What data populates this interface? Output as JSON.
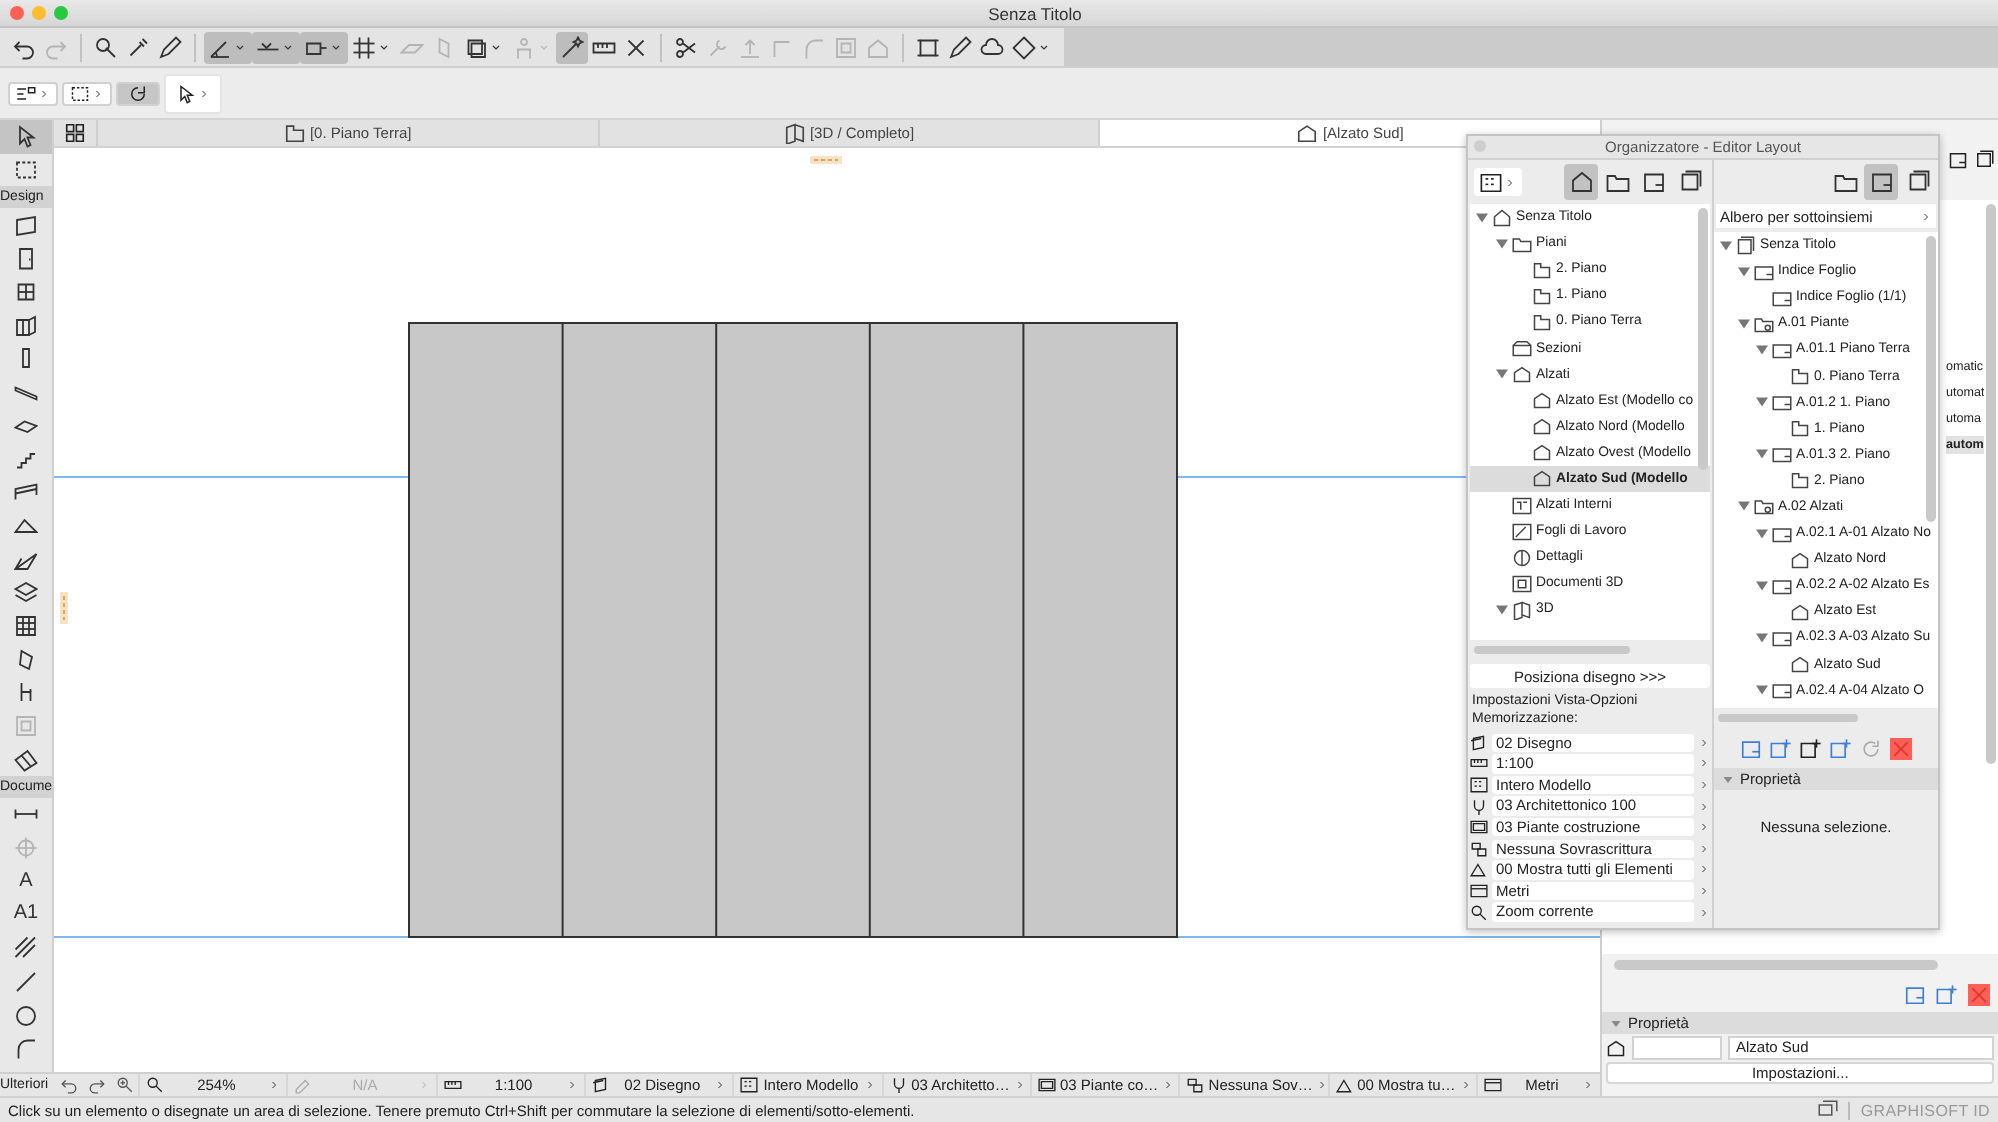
{
  "window": {
    "title": "Senza Titolo"
  },
  "toolbar_groups": [
    {
      "items": [
        {
          "kind": "undo",
          "on": false,
          "disabled": false,
          "menu": false
        },
        {
          "kind": "redo",
          "on": false,
          "disabled": true,
          "menu": false
        }
      ]
    },
    {
      "items": [
        {
          "kind": "pick",
          "on": false,
          "disabled": false,
          "menu": false
        },
        {
          "kind": "eyedropper",
          "on": false,
          "disabled": false,
          "menu": false
        },
        {
          "kind": "pen",
          "on": false,
          "disabled": false,
          "menu": false
        }
      ]
    },
    {
      "items": [
        {
          "kind": "angle",
          "on": true,
          "disabled": false,
          "menu": true
        },
        {
          "kind": "guide",
          "on": true,
          "disabled": false,
          "menu": true
        },
        {
          "kind": "gravity",
          "on": true,
          "disabled": false,
          "menu": true
        },
        {
          "kind": "grid",
          "on": false,
          "disabled": false,
          "menu": true
        },
        {
          "kind": "plane",
          "on": false,
          "disabled": true,
          "menu": false
        },
        {
          "kind": "wallplane",
          "on": false,
          "disabled": true,
          "menu": false
        },
        {
          "kind": "layers",
          "on": false,
          "disabled": false,
          "menu": true
        },
        {
          "kind": "person",
          "on": false,
          "disabled": true,
          "menu": true
        },
        {
          "kind": "wand",
          "on": true,
          "disabled": false,
          "menu": false
        },
        {
          "kind": "ruler",
          "on": false,
          "disabled": false,
          "menu": false
        },
        {
          "kind": "cross",
          "on": false,
          "disabled": false,
          "menu": false
        }
      ]
    },
    {
      "items": [
        {
          "kind": "scissors",
          "on": false,
          "disabled": false,
          "menu": false
        },
        {
          "kind": "wrench",
          "on": false,
          "disabled": true,
          "menu": false
        },
        {
          "kind": "elevate",
          "on": false,
          "disabled": true,
          "menu": false
        },
        {
          "kind": "corner",
          "on": false,
          "disabled": true,
          "menu": false
        },
        {
          "kind": "arc",
          "on": false,
          "disabled": true,
          "menu": false
        },
        {
          "kind": "zone",
          "on": false,
          "disabled": true,
          "menu": false
        },
        {
          "kind": "house",
          "on": false,
          "disabled": true,
          "menu": false
        }
      ]
    },
    {
      "items": [
        {
          "kind": "frame",
          "on": false,
          "disabled": false,
          "menu": false
        },
        {
          "kind": "pen",
          "on": false,
          "disabled": false,
          "menu": false
        },
        {
          "kind": "cloud",
          "on": false,
          "disabled": false,
          "menu": false
        },
        {
          "kind": "diamond",
          "on": false,
          "disabled": false,
          "menu": true
        }
      ]
    }
  ],
  "tool_options": [
    {
      "kind": "filter",
      "on": false,
      "menu": true
    },
    {
      "kind": "marquee",
      "on": false,
      "menu": true
    },
    {
      "kind": "rotate",
      "on": true,
      "menu": false
    },
    {
      "kind": "arrow",
      "on": false,
      "menu": true
    }
  ],
  "view_tabs": [
    {
      "kind": "story",
      "label": "[0. Piano Terra]",
      "selected": false
    },
    {
      "kind": "threed",
      "label": "[3D / Completo]",
      "selected": false
    },
    {
      "kind": "elevation",
      "label": "[Alzato Sud]",
      "selected": true
    }
  ],
  "toolbox": {
    "top_tools": [
      {
        "kind": "arrow",
        "selected": true,
        "disabled": false
      },
      {
        "kind": "marquee",
        "selected": false,
        "disabled": false
      }
    ],
    "sections": [
      {
        "label": "Design",
        "tools": [
          {
            "kind": "wall",
            "selected": false,
            "disabled": false
          },
          {
            "kind": "door",
            "selected": false,
            "disabled": false
          },
          {
            "kind": "window",
            "selected": false,
            "disabled": false
          },
          {
            "kind": "cornerwindow",
            "selected": false,
            "disabled": false
          },
          {
            "kind": "column",
            "selected": false,
            "disabled": false
          },
          {
            "kind": "beam",
            "selected": false,
            "disabled": false
          },
          {
            "kind": "slab",
            "selected": false,
            "disabled": false
          },
          {
            "kind": "stair",
            "selected": false,
            "disabled": false
          },
          {
            "kind": "railing",
            "selected": false,
            "disabled": false
          },
          {
            "kind": "roof",
            "selected": false,
            "disabled": false
          },
          {
            "kind": "shell",
            "selected": false,
            "disabled": false
          },
          {
            "kind": "skylight",
            "selected": false,
            "disabled": false
          },
          {
            "kind": "curtainwall",
            "selected": false,
            "disabled": false
          },
          {
            "kind": "morph",
            "selected": false,
            "disabled": false
          },
          {
            "kind": "object",
            "selected": false,
            "disabled": false
          },
          {
            "kind": "zone",
            "selected": false,
            "disabled": true
          },
          {
            "kind": "mesh",
            "selected": false,
            "disabled": false
          }
        ]
      },
      {
        "label": "Docume",
        "tools": [
          {
            "kind": "dimension",
            "selected": false,
            "disabled": false
          },
          {
            "kind": "level",
            "selected": false,
            "disabled": true
          },
          {
            "kind": "text",
            "glyph": "A",
            "selected": false,
            "disabled": false
          },
          {
            "kind": "label",
            "glyph": "A1",
            "selected": false,
            "disabled": false
          },
          {
            "kind": "fill",
            "selected": false,
            "disabled": false
          },
          {
            "kind": "line",
            "selected": false,
            "disabled": false
          },
          {
            "kind": "circle",
            "selected": false,
            "disabled": false
          },
          {
            "kind": "arc",
            "selected": false,
            "disabled": false
          }
        ]
      }
    ],
    "more_label": "Ulteriori"
  },
  "status_bar": {
    "items": [
      {
        "kind": "zoom",
        "text": "254%",
        "disabled": false
      },
      {
        "kind": "markup",
        "text": "N/A",
        "disabled": true
      },
      {
        "kind": "scale",
        "text": "1:100",
        "disabled": false
      },
      {
        "kind": "layer-combo",
        "text": "02 Disegno",
        "disabled": false
      },
      {
        "kind": "model",
        "text": "Intero Modello",
        "disabled": false
      },
      {
        "kind": "pen-set",
        "text": "03 Architetto…",
        "disabled": false
      },
      {
        "kind": "mvo",
        "text": "03 Piante co…",
        "disabled": false
      },
      {
        "kind": "override",
        "text": "Nessuna Sov…",
        "disabled": false
      },
      {
        "kind": "renovation",
        "text": "00 Mostra tu…",
        "disabled": false
      },
      {
        "kind": "units",
        "text": "Metri",
        "disabled": false
      }
    ]
  },
  "message": "Click su un elemento o disegnate un area di selezione. Tenere premuto Ctrl+Shift per commutare la selezione di elementi/sotto-elementi.",
  "brand": "GRAPHISOFT ID",
  "side_panel": {
    "cut_texts": [
      {
        "text": "omatic",
        "bold": false
      },
      {
        "text": "utomat",
        "bold": false
      },
      {
        "text": "utoma",
        "bold": false
      },
      {
        "text": "autom",
        "bold": true
      }
    ],
    "properties_title": "Proprietà",
    "name_value": "Alzato Sud",
    "settings_button": "Impostazioni..."
  },
  "organizer": {
    "title": "Organizzatore - Editor Layout",
    "left_modes": [
      {
        "kind": "project",
        "selected": true
      },
      {
        "kind": "viewmap",
        "selected": false
      },
      {
        "kind": "layout",
        "selected": false
      },
      {
        "kind": "publisher",
        "selected": false
      }
    ],
    "view_tree": [
      {
        "kind": "project",
        "label": "Senza Titolo",
        "selected": false,
        "expanded": true,
        "children": [
          {
            "kind": "folder",
            "label": "Piani",
            "selected": false,
            "expanded": true,
            "children": [
              {
                "kind": "story",
                "label": "2. Piano",
                "selected": false
              },
              {
                "kind": "story",
                "label": "1. Piano",
                "selected": false
              },
              {
                "kind": "story",
                "label": "0. Piano Terra",
                "selected": false
              }
            ]
          },
          {
            "kind": "section",
            "label": "Sezioni",
            "selected": false
          },
          {
            "kind": "elevation",
            "label": "Alzati",
            "selected": false,
            "expanded": true,
            "children": [
              {
                "kind": "elevation",
                "label": "Alzato Est (Modello co",
                "selected": false
              },
              {
                "kind": "elevation",
                "label": "Alzato Nord (Modello",
                "selected": false
              },
              {
                "kind": "elevation",
                "label": "Alzato Ovest (Modello",
                "selected": false
              },
              {
                "kind": "elevation",
                "label": "Alzato Sud (Modello",
                "selected": true
              }
            ]
          },
          {
            "kind": "interior",
            "label": "Alzati Interni",
            "selected": false
          },
          {
            "kind": "worksheet",
            "label": "Fogli di Lavoro",
            "selected": false
          },
          {
            "kind": "detail",
            "label": "Dettagli",
            "selected": false
          },
          {
            "kind": "document",
            "label": "Documenti 3D",
            "selected": false
          },
          {
            "kind": "threed",
            "label": "3D",
            "selected": false,
            "expanded": true
          }
        ]
      }
    ],
    "place_button": "Posiziona disegno >>>",
    "settings_label": "Impostazioni Vista-Opzioni Memorizzazione:",
    "settings": [
      {
        "kind": "layer-combo",
        "label": "02 Disegno"
      },
      {
        "kind": "scale",
        "label": "1:100"
      },
      {
        "kind": "model",
        "label": "Intero Modello"
      },
      {
        "kind": "pen-set",
        "label": "03 Architettonico 100"
      },
      {
        "kind": "mvo",
        "label": "03 Piante costruzione"
      },
      {
        "kind": "override",
        "label": "Nessuna Sovrascrittura"
      },
      {
        "kind": "renovation",
        "label": "00 Mostra tutti gli Elementi"
      },
      {
        "kind": "units",
        "label": "Metri"
      },
      {
        "kind": "zoom",
        "label": "Zoom corrente"
      }
    ],
    "right_modes": [
      {
        "kind": "viewmap",
        "selected": false
      },
      {
        "kind": "layout",
        "selected": true
      },
      {
        "kind": "publisher",
        "selected": false
      }
    ],
    "subset_dropdown": "Albero per sottoinsiemi",
    "layout_tree": [
      {
        "kind": "layoutbook",
        "label": "Senza Titolo",
        "selected": false,
        "expanded": true,
        "children": [
          {
            "kind": "sheet",
            "label": "Indice Foglio",
            "selected": false,
            "expanded": true,
            "children": [
              {
                "kind": "sheet",
                "label": "Indice Foglio (1/1)",
                "selected": false
              }
            ]
          },
          {
            "kind": "subset",
            "label": "A.01 Piante",
            "selected": false,
            "expanded": true,
            "children": [
              {
                "kind": "sheet",
                "label": "A.01.1 Piano Terra",
                "selected": false,
                "expanded": true,
                "children": [
                  {
                    "kind": "story",
                    "label": "0. Piano Terra",
                    "selected": false
                  }
                ]
              },
              {
                "kind": "sheet",
                "label": "A.01.2 1. Piano",
                "selected": false,
                "expanded": true,
                "children": [
                  {
                    "kind": "story",
                    "label": "1. Piano",
                    "selected": false
                  }
                ]
              },
              {
                "kind": "sheet",
                "label": "A.01.3 2. Piano",
                "selected": false,
                "expanded": true,
                "children": [
                  {
                    "kind": "story",
                    "label": "2. Piano",
                    "selected": false
                  }
                ]
              }
            ]
          },
          {
            "kind": "subset",
            "label": "A.02 Alzati",
            "selected": false,
            "expanded": true,
            "children": [
              {
                "kind": "sheet",
                "label": "A.02.1 A-01 Alzato No",
                "selected": false,
                "expanded": true,
                "children": [
                  {
                    "kind": "elevation",
                    "label": "Alzato Nord",
                    "selected": false
                  }
                ]
              },
              {
                "kind": "sheet",
                "label": "A.02.2 A-02 Alzato Es",
                "selected": false,
                "expanded": true,
                "children": [
                  {
                    "kind": "elevation",
                    "label": "Alzato Est",
                    "selected": false
                  }
                ]
              },
              {
                "kind": "sheet",
                "label": "A.02.3 A-03 Alzato Su",
                "selected": false,
                "expanded": true,
                "children": [
                  {
                    "kind": "elevation",
                    "label": "Alzato Sud",
                    "selected": false
                  }
                ]
              },
              {
                "kind": "sheet",
                "label": "A.02.4 A-04 Alzato O",
                "selected": false,
                "expanded": true
              }
            ]
          }
        ]
      }
    ],
    "properties_title": "Proprietà",
    "properties_empty": "Nessuna selezione."
  }
}
